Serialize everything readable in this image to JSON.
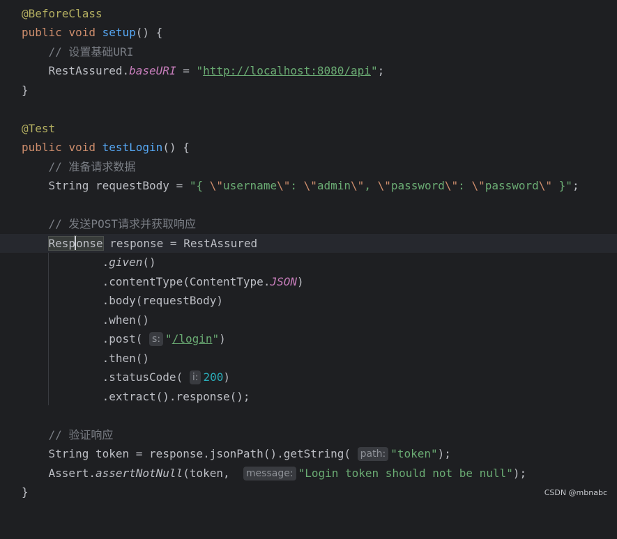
{
  "annotations": {
    "before_class": "@BeforeClass",
    "test": "@Test"
  },
  "keywords": {
    "public": "public",
    "void": "void"
  },
  "setup": {
    "method_name": "setup",
    "comment": "// 设置基础URI",
    "class_name": "RestAssured",
    "field": "baseURI",
    "url": "http://localhost:8080/api"
  },
  "test_login": {
    "method_name": "testLogin",
    "comment1": "// 准备请求数据",
    "string_type": "String",
    "request_body_var": "requestBody",
    "json_parts": [
      "{ ",
      "\\\"",
      "username",
      "\\\"",
      ": ",
      "\\\"",
      "admin",
      "\\\"",
      ", ",
      "\\\"",
      "password",
      "\\\"",
      ": ",
      "\\\"",
      "password",
      "\\\"",
      " }"
    ],
    "comment2": "// 发送POST请求并获取响应",
    "response_type_a": "Resp",
    "response_type_b": "onse",
    "response_var": "response",
    "rest_assured": "RestAssured",
    "given": "given",
    "content_type": "contentType",
    "content_type_class": "ContentType",
    "json_const": "JSON",
    "body": "body",
    "when": "when",
    "post": "post",
    "post_hint": "s:",
    "post_path": "/login",
    "then": "then",
    "status_code": "statusCode",
    "status_hint": "i:",
    "status_value": "200",
    "extract_chain": ".extract().response();",
    "comment3": "// 验证响应",
    "token_var": "token",
    "json_path_chain": "response.jsonPath().getString(",
    "path_hint": "path:",
    "token_key": "token",
    "assert_class": "Assert",
    "assert_method": "assertNotNull",
    "message_hint": "message:",
    "message_text": "Login token should not be null"
  },
  "watermark": "CSDN @mbnabc"
}
